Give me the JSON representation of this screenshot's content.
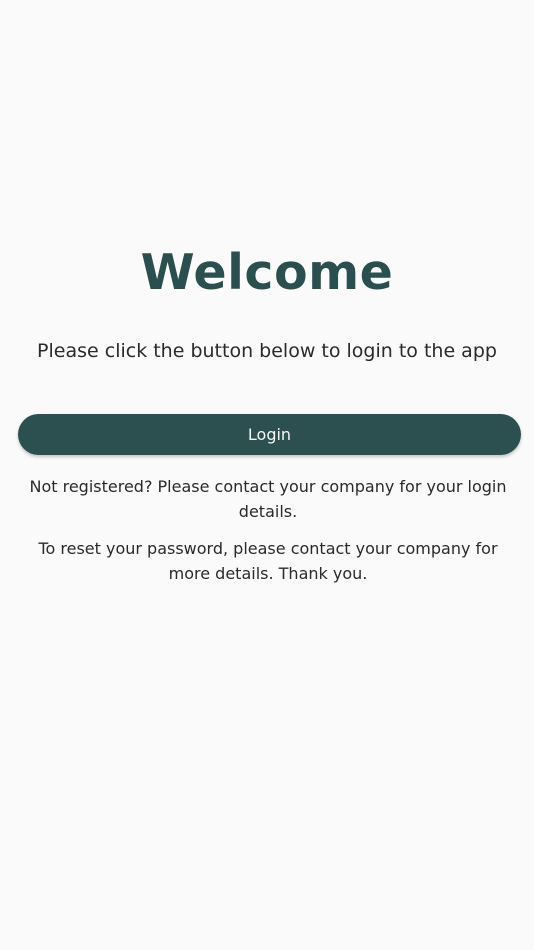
{
  "welcome": {
    "title": "Welcome",
    "intro": "Please click the button below to login to the app"
  },
  "login_button": {
    "label": "Login",
    "color": "#2c4f4f"
  },
  "info": {
    "not_registered": "Not registered? Please contact your company for your login details.",
    "reset_password": "To reset your password, please contact your company for more details. Thank you."
  },
  "theme": {
    "accent": "#2b4f4f",
    "background": "#fafafa"
  }
}
